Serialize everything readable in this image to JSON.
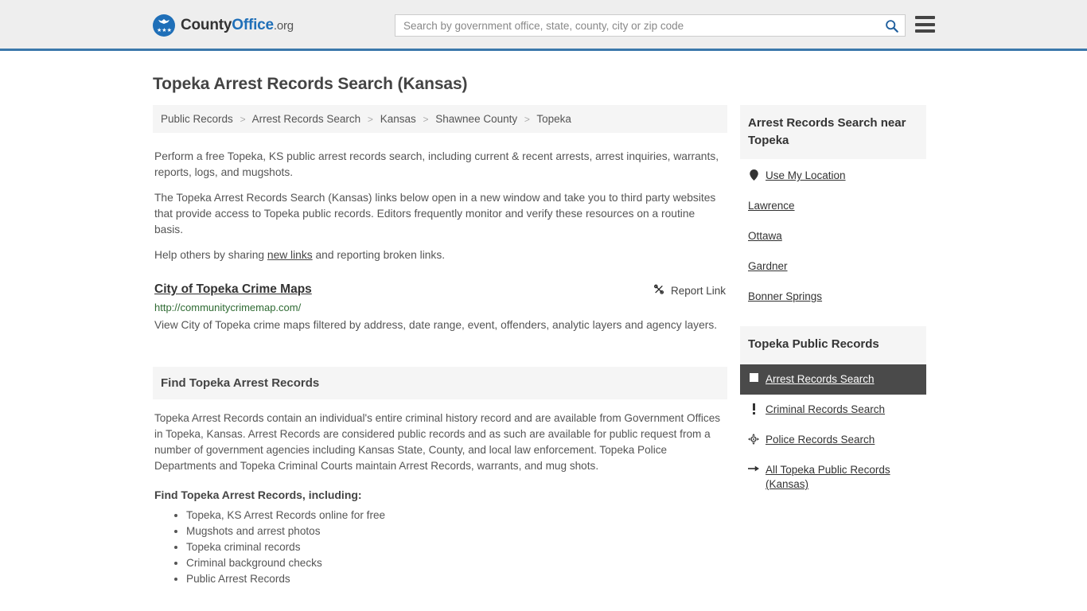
{
  "header": {
    "logo": {
      "icon": "eagle-seal-icon",
      "text_county": "County",
      "text_office": "Office",
      "text_tld": ".org"
    },
    "search": {
      "placeholder": "Search by government office, state, county, city or zip code",
      "value": "",
      "icon": "search-icon"
    },
    "menu_icon": "hamburger-menu-icon"
  },
  "page": {
    "title": "Topeka Arrest Records Search (Kansas)"
  },
  "breadcrumb": {
    "separator": ">",
    "items": [
      {
        "label": "Public Records"
      },
      {
        "label": "Arrest Records Search"
      },
      {
        "label": "Kansas"
      },
      {
        "label": "Shawnee County"
      },
      {
        "label": "Topeka"
      }
    ]
  },
  "intro": {
    "p1": "Perform a free Topeka, KS public arrest records search, including current & recent arrests, arrest inquiries, warrants, reports, logs, and mugshots.",
    "p2": "The Topeka Arrest Records Search (Kansas) links below open in a new window and take you to third party websites that provide access to Topeka public records. Editors frequently monitor and verify these resources on a routine basis.",
    "p3_before": "Help others by sharing ",
    "p3_link": "new links",
    "p3_after": " and reporting broken links."
  },
  "result": {
    "title": "City of Topeka Crime Maps",
    "report_label": "Report Link",
    "report_icon": "broken-link-icon",
    "url": "http://communitycrimemap.com/",
    "description": "View City of Topeka crime maps filtered by address, date range, event, offenders, analytic layers and agency layers."
  },
  "section": {
    "heading": "Find Topeka Arrest Records",
    "paragraph": "Topeka Arrest Records contain an individual's entire criminal history record and are available from Government Offices in Topeka, Kansas. Arrest Records are considered public records and as such are available for public request from a number of government agencies including Kansas State, County, and local law enforcement. Topeka Police Departments and Topeka Criminal Courts maintain Arrest Records, warrants, and mug shots.",
    "sub_heading": "Find Topeka Arrest Records, including:",
    "bullets": [
      "Topeka, KS Arrest Records online for free",
      "Mugshots and arrest photos",
      "Topeka criminal records",
      "Criminal background checks",
      "Public Arrest Records"
    ]
  },
  "sidebar": {
    "near": {
      "heading": "Arrest Records Search near Topeka",
      "items": [
        {
          "label": "Use My Location",
          "icon": "map-pin-icon"
        },
        {
          "label": "Lawrence",
          "icon": ""
        },
        {
          "label": "Ottawa",
          "icon": ""
        },
        {
          "label": "Gardner",
          "icon": ""
        },
        {
          "label": "Bonner Springs",
          "icon": ""
        }
      ]
    },
    "records": {
      "heading": "Topeka Public Records",
      "items": [
        {
          "label": "Arrest Records Search",
          "icon": "square-icon",
          "active": true
        },
        {
          "label": "Criminal Records Search",
          "icon": "exclamation-icon",
          "active": false
        },
        {
          "label": "Police Records Search",
          "icon": "crosshair-icon",
          "active": false
        },
        {
          "label": "All Topeka Public Records (Kansas)",
          "icon": "arrow-right-icon",
          "active": false
        }
      ]
    }
  },
  "colors": {
    "brand_blue": "#1f6fb8",
    "header_rule": "#3b78ab",
    "panel_bg": "#f5f5f5",
    "active_bg": "#4a4a4a",
    "url_green": "#2f6b33"
  }
}
